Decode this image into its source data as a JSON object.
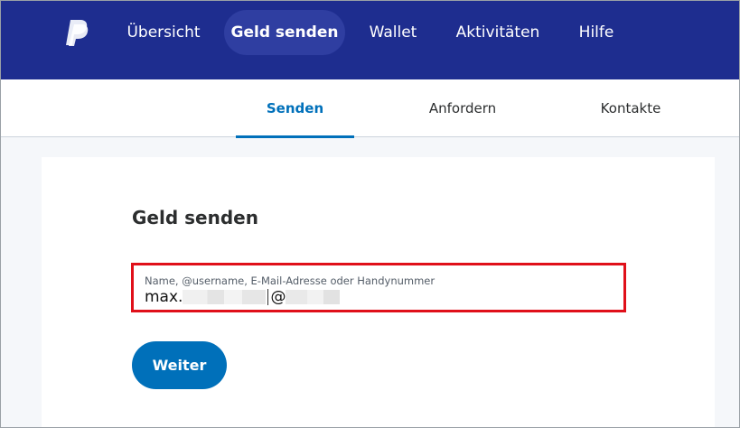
{
  "brand": {
    "logo_icon": "paypal-logo-icon",
    "color": "#1e2d8f",
    "accent": "#0070ba"
  },
  "topnav": {
    "items": [
      {
        "label": "Übersicht",
        "active": false
      },
      {
        "label": "Geld senden",
        "active": true
      },
      {
        "label": "Wallet",
        "active": false
      },
      {
        "label": "Aktivitäten",
        "active": false
      },
      {
        "label": "Hilfe",
        "active": false
      }
    ]
  },
  "subnav": {
    "tabs": [
      {
        "label": "Senden",
        "active": true
      },
      {
        "label": "Anfordern",
        "active": false
      },
      {
        "label": "Kontakte",
        "active": false
      }
    ]
  },
  "form": {
    "title": "Geld senden",
    "recipient": {
      "label": "Name, @username, E-Mail-Adresse oder Handynummer",
      "value_prefix": "max.",
      "value_at": "@",
      "highlight_color": "#e0101a"
    },
    "submit_label": "Weiter"
  }
}
